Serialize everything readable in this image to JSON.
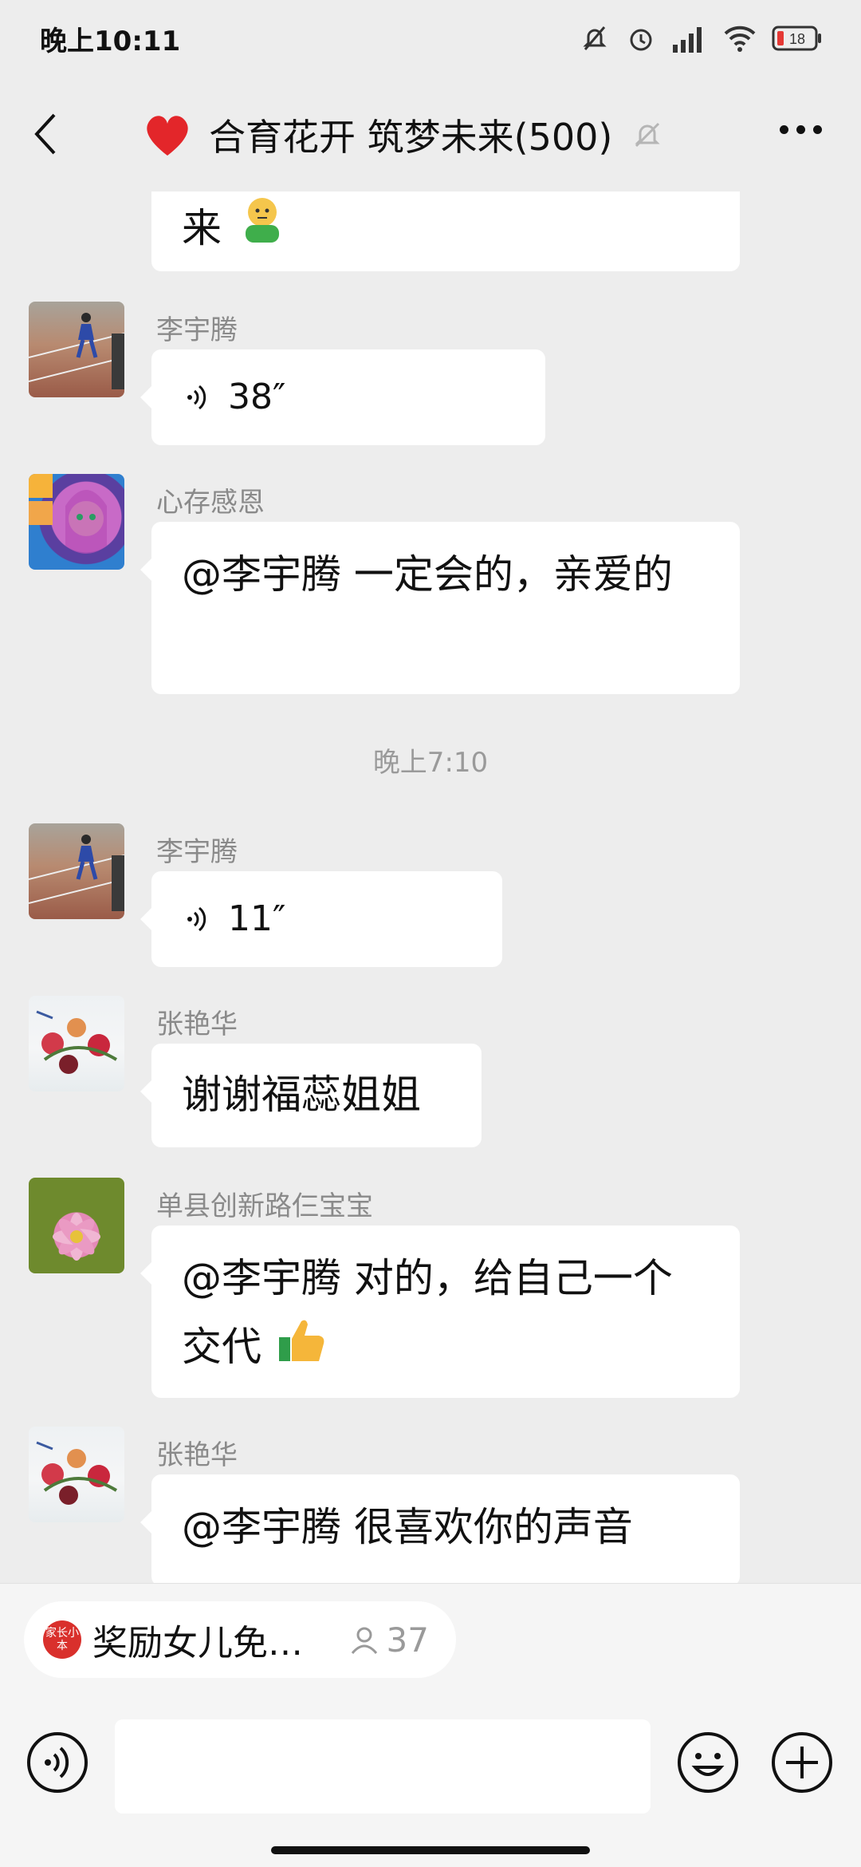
{
  "status": {
    "time": "晚上10:11",
    "battery": "18"
  },
  "header": {
    "title": "合育花开 筑梦未来(500)"
  },
  "chat": {
    "top_fragment": "来",
    "messages": [
      {
        "sender": "李宇腾",
        "voice": "38″"
      },
      {
        "sender": "心存感恩",
        "text": "@李宇腾  一定会的，亲爱的"
      },
      {
        "sender": "李宇腾",
        "voice": "11″"
      },
      {
        "sender": "张艳华",
        "text": "谢谢福蕊姐姐"
      },
      {
        "sender": "单县创新路仨宝宝",
        "text": "@李宇腾  对的，给自己一个交代"
      },
      {
        "sender": "张艳华",
        "text": "@李宇腾  很喜欢你的声音"
      }
    ],
    "time_separator": "晚上7:10"
  },
  "mini_program": {
    "logo_text": "家长小本",
    "title": "奖励女儿免…",
    "count": "37"
  },
  "colors": {
    "background": "#ededed",
    "bubble": "#ffffff",
    "heart": "#e3262a"
  }
}
